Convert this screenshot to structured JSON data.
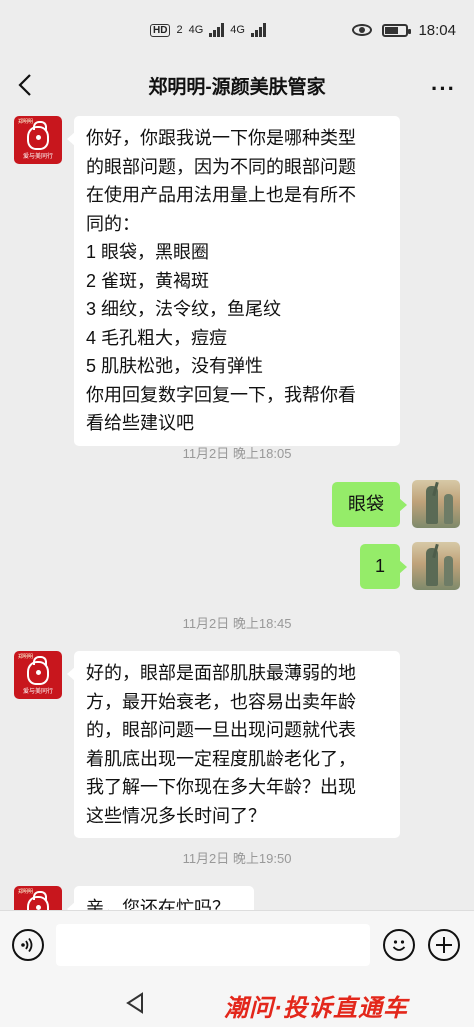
{
  "status_bar": {
    "network_badge": "HD",
    "sim_number": "2",
    "signal1": "4G",
    "signal2": "4G",
    "time": "18:04"
  },
  "header": {
    "title": "郑明明-源颜美肤管家",
    "more_label": "···"
  },
  "shop_avatar": {
    "caption": "爱与美同行",
    "top": "郑明明"
  },
  "messages": [
    {
      "sender": "shop",
      "lines": [
        "你好，你跟我说一下你是哪种类型",
        "的眼部问题，因为不同的眼部问题",
        "在使用产品用法用量上也是有所不",
        "同的：",
        "1 眼袋，黑眼圈",
        "2 雀斑，黄褐斑",
        "3 细纹，法令纹，鱼尾纹",
        "4 毛孔粗大，痘痘",
        "5 肌肤松弛，没有弹性",
        "你用回复数字回复一下，我帮你看",
        "看给些建议吧"
      ]
    },
    {
      "timestamp": "11月2日 晚上18:05"
    },
    {
      "sender": "user",
      "text": "眼袋"
    },
    {
      "sender": "user",
      "text": "1"
    },
    {
      "timestamp": "11月2日 晚上18:45"
    },
    {
      "sender": "shop",
      "lines": [
        "好的，眼部是面部肌肤最薄弱的地",
        "方，最开始衰老，也容易出卖年龄",
        "的，眼部问题一旦出现问题就代表",
        "着肌底出现一定程度肌龄老化了，",
        "我了解一下你现在多大年龄？出现",
        "这些情况多长时间了？"
      ]
    },
    {
      "timestamp": "11月2日 晚上19:50"
    },
    {
      "sender": "shop",
      "text": "亲，您还在忙吗？"
    }
  ],
  "input_bar": {
    "voice_icon": "voice-icon",
    "emoji_icon": "emoji-icon",
    "plus_icon": "plus-icon"
  },
  "watermark": "潮问·投诉直通车",
  "colors": {
    "background": "#ededed",
    "user_bubble": "#95ec69",
    "shop_bubble": "#ffffff",
    "shop_avatar": "#c8161d",
    "watermark": "#e3271b"
  }
}
